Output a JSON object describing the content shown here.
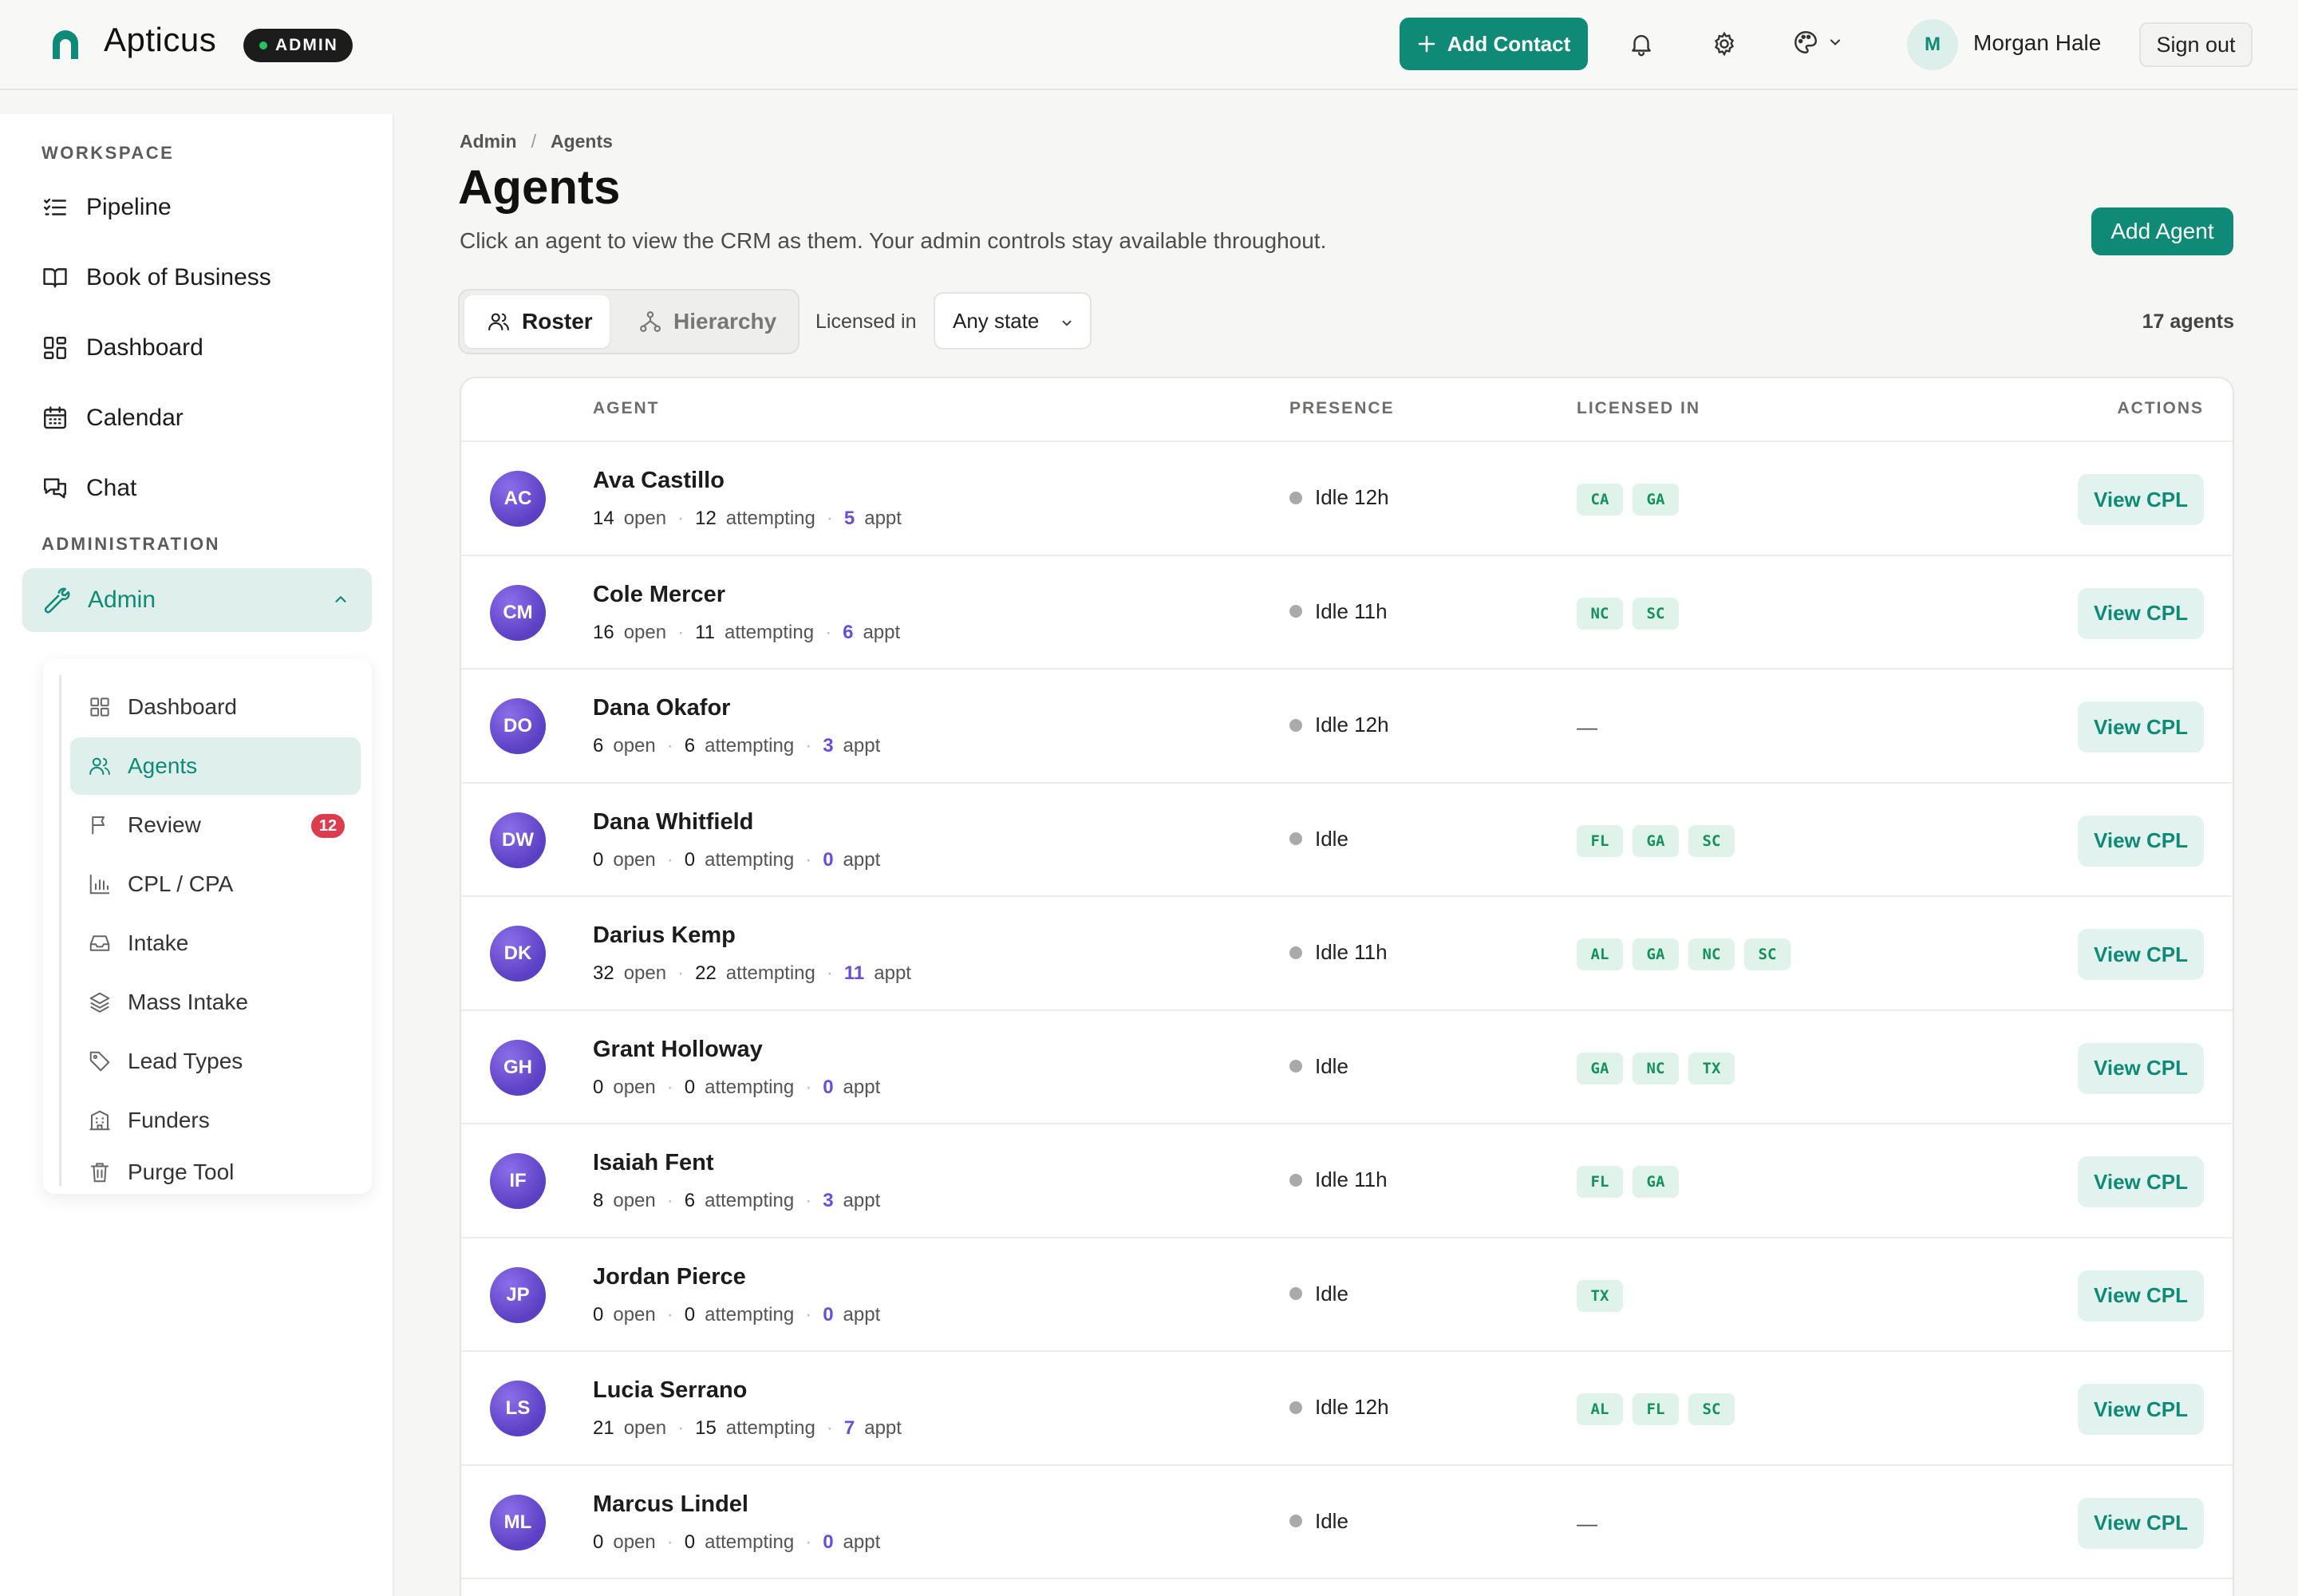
{
  "app": {
    "name": "Apticus",
    "badge": "ADMIN"
  },
  "header": {
    "add_contact_label": "Add Contact",
    "user_initial": "M",
    "user_name": "Morgan Hale",
    "sign_out_label": "Sign out",
    "icons": [
      "bell-icon",
      "gear-icon",
      "palette-icon",
      "chevron-down-icon"
    ]
  },
  "sidebar": {
    "workspace_label": "WORKSPACE",
    "workspace_items": [
      {
        "label": "Pipeline",
        "icon": "checklist-icon"
      },
      {
        "label": "Book of Business",
        "icon": "book-icon"
      },
      {
        "label": "Dashboard",
        "icon": "dashboard-icon"
      },
      {
        "label": "Calendar",
        "icon": "calendar-icon"
      },
      {
        "label": "Chat",
        "icon": "chat-icon"
      }
    ],
    "administration_label": "ADMINISTRATION",
    "admin_label": "Admin",
    "admin_items": [
      {
        "label": "Dashboard",
        "icon": "grid-icon"
      },
      {
        "label": "Agents",
        "icon": "users-icon",
        "active": true
      },
      {
        "label": "Review",
        "icon": "flag-icon",
        "badge": "12"
      },
      {
        "label": "CPL / CPA",
        "icon": "bar-chart-icon"
      },
      {
        "label": "Intake",
        "icon": "inbox-icon"
      },
      {
        "label": "Mass Intake",
        "icon": "layers-icon"
      },
      {
        "label": "Lead Types",
        "icon": "tag-icon"
      },
      {
        "label": "Funders",
        "icon": "building-icon"
      },
      {
        "label": "Purge Tool",
        "icon": "trash-icon"
      }
    ]
  },
  "breadcrumb": {
    "root": "Admin",
    "separator": "/",
    "current": "Agents"
  },
  "page": {
    "title": "Agents",
    "subtitle": "Click an agent to view the CRM as them. Your admin controls stay available throughout.",
    "add_agent_label": "Add Agent"
  },
  "toolbar": {
    "roster_label": "Roster",
    "hierarchy_label": "Hierarchy",
    "licensed_in_label": "Licensed in",
    "state_value": "Any state",
    "agent_count": "17 agents"
  },
  "table": {
    "columns": {
      "agent": "AGENT",
      "presence": "PRESENCE",
      "licensed": "LICENSED IN",
      "actions": "ACTIONS"
    },
    "labels": {
      "open": "open",
      "attempting": "attempting",
      "appt": "appt",
      "view_cpl": "View CPL",
      "none": "—"
    },
    "rows": [
      {
        "initials": "AC",
        "name": "Ava Castillo",
        "open": "14",
        "attempting": "12",
        "appt": "5",
        "presence": "Idle 12h",
        "states": [
          "CA",
          "GA"
        ]
      },
      {
        "initials": "CM",
        "name": "Cole Mercer",
        "open": "16",
        "attempting": "11",
        "appt": "6",
        "presence": "Idle 11h",
        "states": [
          "NC",
          "SC"
        ]
      },
      {
        "initials": "DO",
        "name": "Dana Okafor",
        "open": "6",
        "attempting": "6",
        "appt": "3",
        "presence": "Idle 12h",
        "states": []
      },
      {
        "initials": "DW",
        "name": "Dana Whitfield",
        "open": "0",
        "attempting": "0",
        "appt": "0",
        "presence": "Idle",
        "states": [
          "FL",
          "GA",
          "SC"
        ]
      },
      {
        "initials": "DK",
        "name": "Darius Kemp",
        "open": "32",
        "attempting": "22",
        "appt": "11",
        "presence": "Idle 11h",
        "states": [
          "AL",
          "GA",
          "NC",
          "SC"
        ]
      },
      {
        "initials": "GH",
        "name": "Grant Holloway",
        "open": "0",
        "attempting": "0",
        "appt": "0",
        "presence": "Idle",
        "states": [
          "GA",
          "NC",
          "TX"
        ]
      },
      {
        "initials": "IF",
        "name": "Isaiah Fent",
        "open": "8",
        "attempting": "6",
        "appt": "3",
        "presence": "Idle 11h",
        "states": [
          "FL",
          "GA"
        ]
      },
      {
        "initials": "JP",
        "name": "Jordan Pierce",
        "open": "0",
        "attempting": "0",
        "appt": "0",
        "presence": "Idle",
        "states": [
          "TX"
        ]
      },
      {
        "initials": "LS",
        "name": "Lucia Serrano",
        "open": "21",
        "attempting": "15",
        "appt": "7",
        "presence": "Idle 12h",
        "states": [
          "AL",
          "FL",
          "SC"
        ]
      },
      {
        "initials": "ML",
        "name": "Marcus Lindel",
        "open": "0",
        "attempting": "0",
        "appt": "0",
        "presence": "Idle",
        "states": []
      }
    ]
  },
  "colors": {
    "accent": "#0f8a76",
    "accent_soft": "#dff0ec",
    "avatar": "#6a4fd6",
    "chip_text": "#14915f",
    "badge_red": "#dc3c4d"
  }
}
